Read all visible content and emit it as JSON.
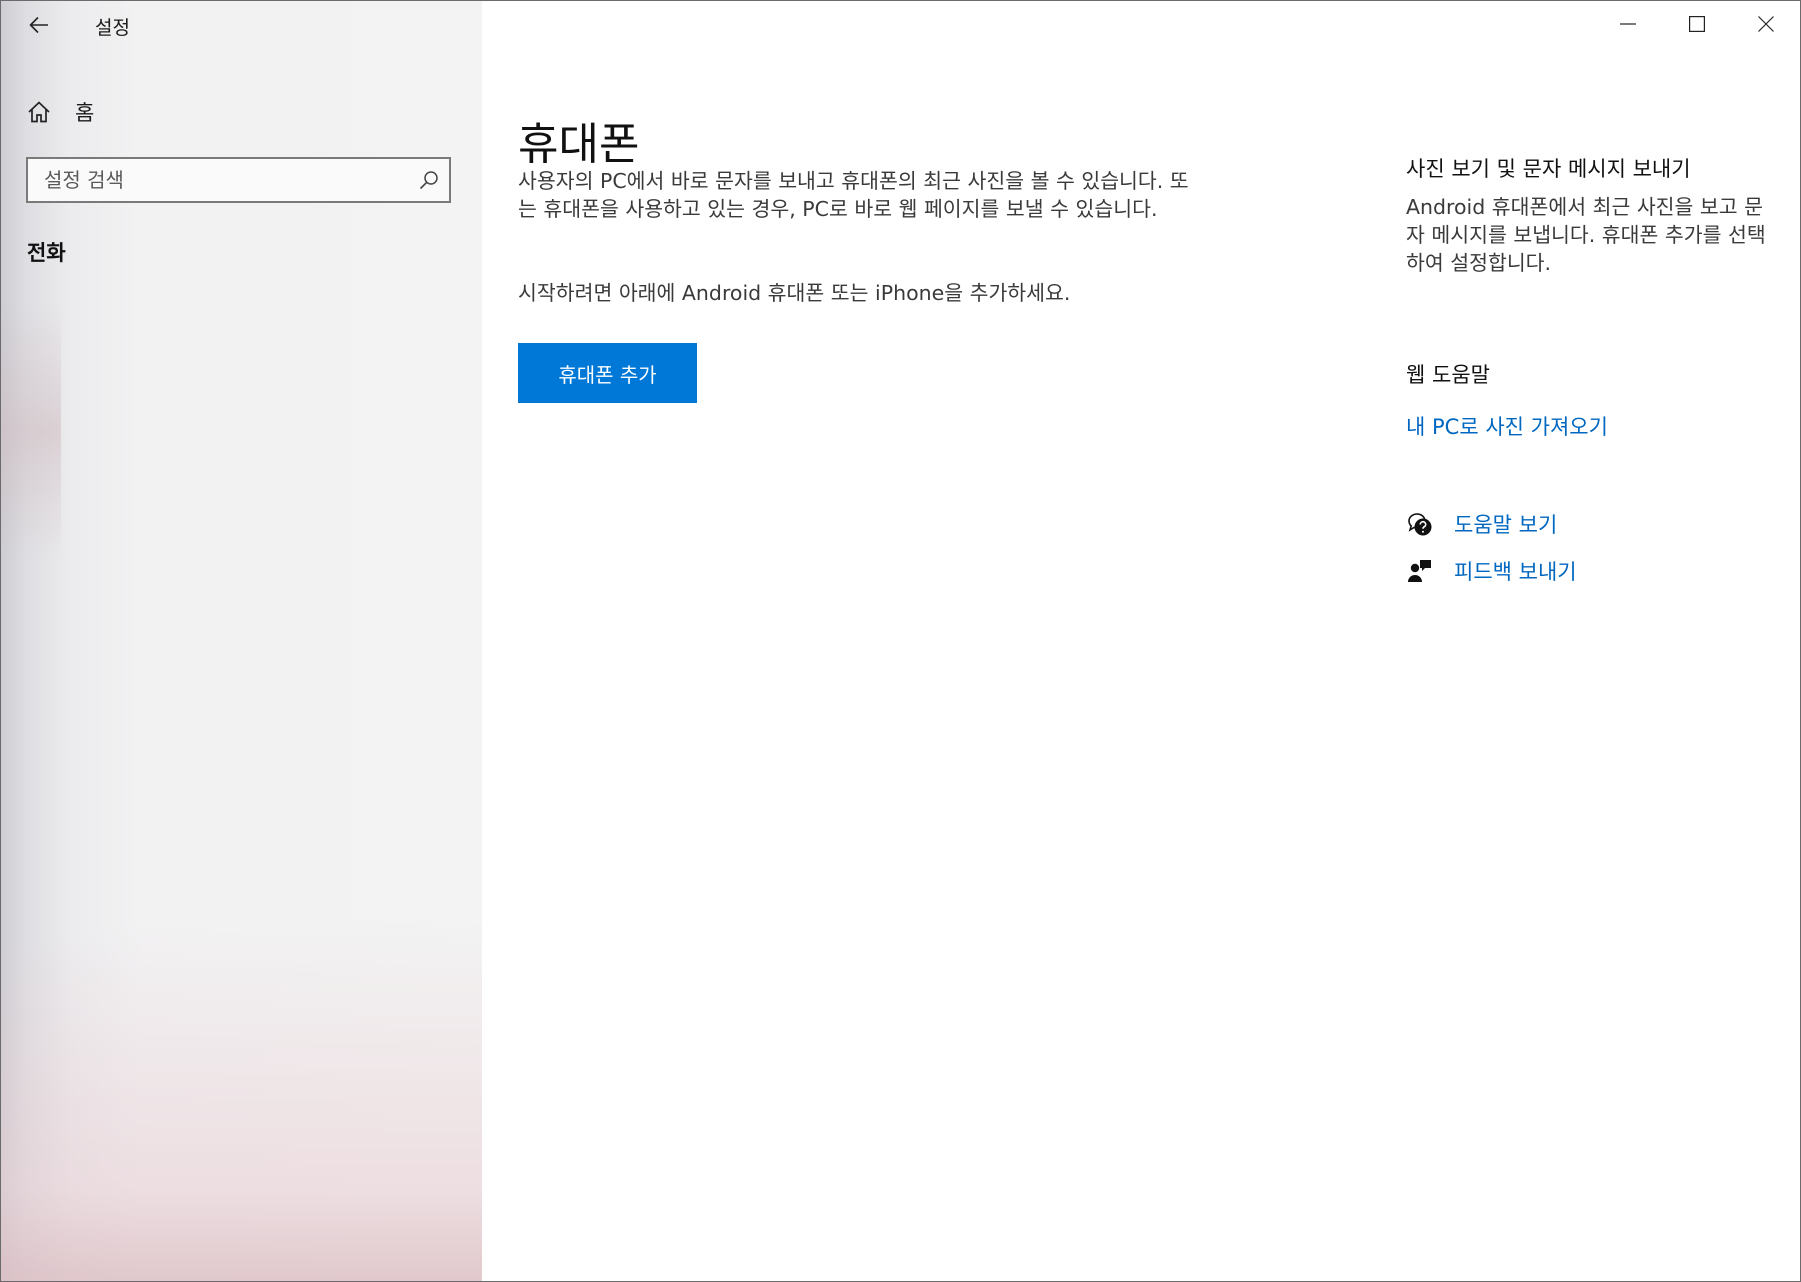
{
  "window": {
    "app_title": "설정",
    "controls": {
      "minimize": "minimize-icon",
      "maximize": "maximize-icon",
      "close": "close-icon"
    }
  },
  "sidebar": {
    "back_icon": "back-arrow-icon",
    "home_label": "홈",
    "home_icon": "home-icon",
    "search": {
      "placeholder": "설정 검색",
      "value": "",
      "icon": "search-icon"
    },
    "section_label": "전화"
  },
  "main": {
    "title": "휴대폰",
    "description": "사용자의 PC에서 바로 문자를 보내고 휴대폰의 최근 사진을 볼 수 있습니다. 또는 휴대폰을 사용하고 있는 경우, PC로 바로 웹 페이지를 보낼 수 있습니다.",
    "instruction": "시작하려면 아래에 Android 휴대폰 또는 iPhone을 추가하세요.",
    "add_button_label": "휴대폰 추가"
  },
  "right_panel": {
    "section1_heading": "사진 보기 및 문자 메시지 보내기",
    "section1_desc": "Android 휴대폰에서 최근 사진을 보고 문자 메시지를 보냅니다. 휴대폰 추가를 선택하여 설정합니다.",
    "web_help_heading": "웹 도움말",
    "web_help_link": "내 PC로 사진 가져오기",
    "help_link": "도움말 보기",
    "help_icon": "help-chat-icon",
    "feedback_link": "피드백 보내기",
    "feedback_icon": "feedback-icon"
  },
  "colors": {
    "accent": "#0078d7",
    "link": "#0067c0",
    "sidebar_bg": "#f3f3f3"
  }
}
